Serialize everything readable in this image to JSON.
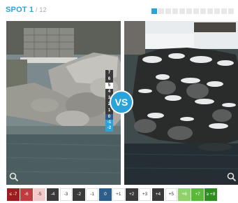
{
  "header": {
    "spot_label": "SPOT 1",
    "total_label": " / 12",
    "current_page": 1,
    "total_pages": 12
  },
  "vs_label": "VS",
  "vertical_scale": [
    "7",
    "6",
    "5",
    "4",
    "3",
    "2",
    "1",
    "0",
    "-1",
    "-2"
  ],
  "scale": [
    {
      "label": "≤ -7",
      "bg": "#9e1b1e",
      "fg": "#ffffff"
    },
    {
      "label": "-6",
      "bg": "#c13b3f",
      "fg": "#ffffff"
    },
    {
      "label": "-5",
      "bg": "#f4c9c9",
      "fg": "#333333"
    },
    {
      "label": "-4",
      "bg": "#3a3a3a",
      "fg": "#ffffff"
    },
    {
      "label": "-3",
      "bg": "#ffffff",
      "fg": "#333333"
    },
    {
      "label": "-2",
      "bg": "#3a3a3a",
      "fg": "#ffffff"
    },
    {
      "label": "-1",
      "bg": "#ffffff",
      "fg": "#333333"
    },
    {
      "label": "0",
      "bg": "#2e5f8c",
      "fg": "#ffffff"
    },
    {
      "label": "+1",
      "bg": "#ffffff",
      "fg": "#333333"
    },
    {
      "label": "+2",
      "bg": "#3a3a3a",
      "fg": "#ffffff"
    },
    {
      "label": "+3",
      "bg": "#ffffff",
      "fg": "#333333"
    },
    {
      "label": "+4",
      "bg": "#3a3a3a",
      "fg": "#ffffff"
    },
    {
      "label": "+5",
      "bg": "#ffffff",
      "fg": "#333333"
    },
    {
      "label": "+6",
      "bg": "#8fd16a",
      "fg": "#ffffff"
    },
    {
      "label": "+7",
      "bg": "#5bb83a",
      "fg": "#ffffff"
    },
    {
      "label": "≥ +8",
      "bg": "#2f8d22",
      "fg": "#ffffff"
    }
  ],
  "icons": {
    "zoom": "magnifier-icon"
  },
  "colors": {
    "accent": "#2aa3db"
  }
}
